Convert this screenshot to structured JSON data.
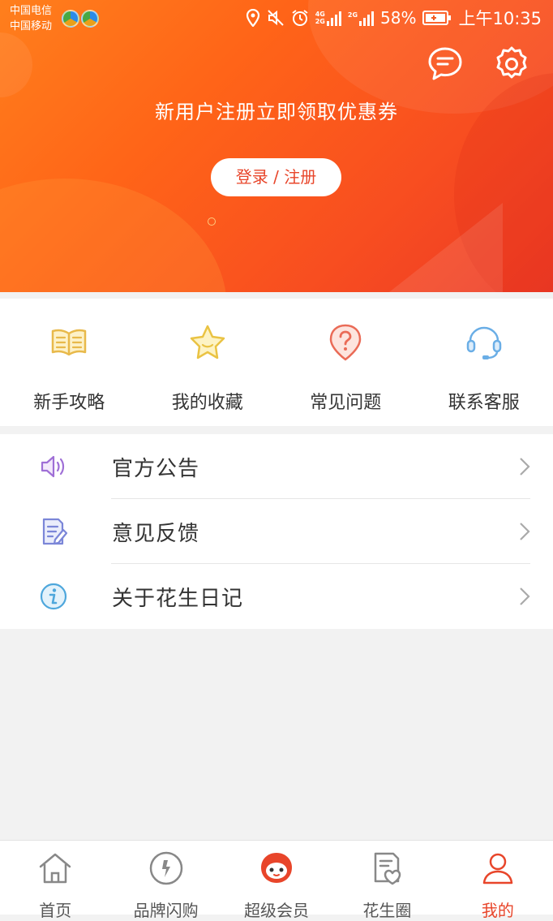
{
  "status_bar": {
    "carrier_1": "中国电信",
    "carrier_2": "中国移动",
    "net_top": "4G",
    "net_bottom": "2G",
    "net2": "2G",
    "battery": "58%",
    "time": "上午10:35"
  },
  "header": {
    "promo_text": "新用户注册立即领取优惠券",
    "login_button": "登录 / 注册"
  },
  "quick_links": [
    {
      "label": "新手攻略",
      "icon": "book-icon"
    },
    {
      "label": "我的收藏",
      "icon": "star-icon"
    },
    {
      "label": "常见问题",
      "icon": "question-icon"
    },
    {
      "label": "联系客服",
      "icon": "headset-icon"
    }
  ],
  "menu": [
    {
      "label": "官方公告",
      "icon": "speaker-icon"
    },
    {
      "label": "意见反馈",
      "icon": "feedback-icon"
    },
    {
      "label": "关于花生日记",
      "icon": "info-icon"
    }
  ],
  "tabs": [
    {
      "label": "首页",
      "icon": "home-icon"
    },
    {
      "label": "品牌闪购",
      "icon": "flash-icon"
    },
    {
      "label": "超级会员",
      "icon": "mascot-icon"
    },
    {
      "label": "花生圈",
      "icon": "circle-icon"
    },
    {
      "label": "我的",
      "icon": "profile-icon"
    }
  ],
  "colors": {
    "accent": "#e8452a",
    "header_start": "#ff7f1c",
    "header_end": "#ec3a26"
  }
}
